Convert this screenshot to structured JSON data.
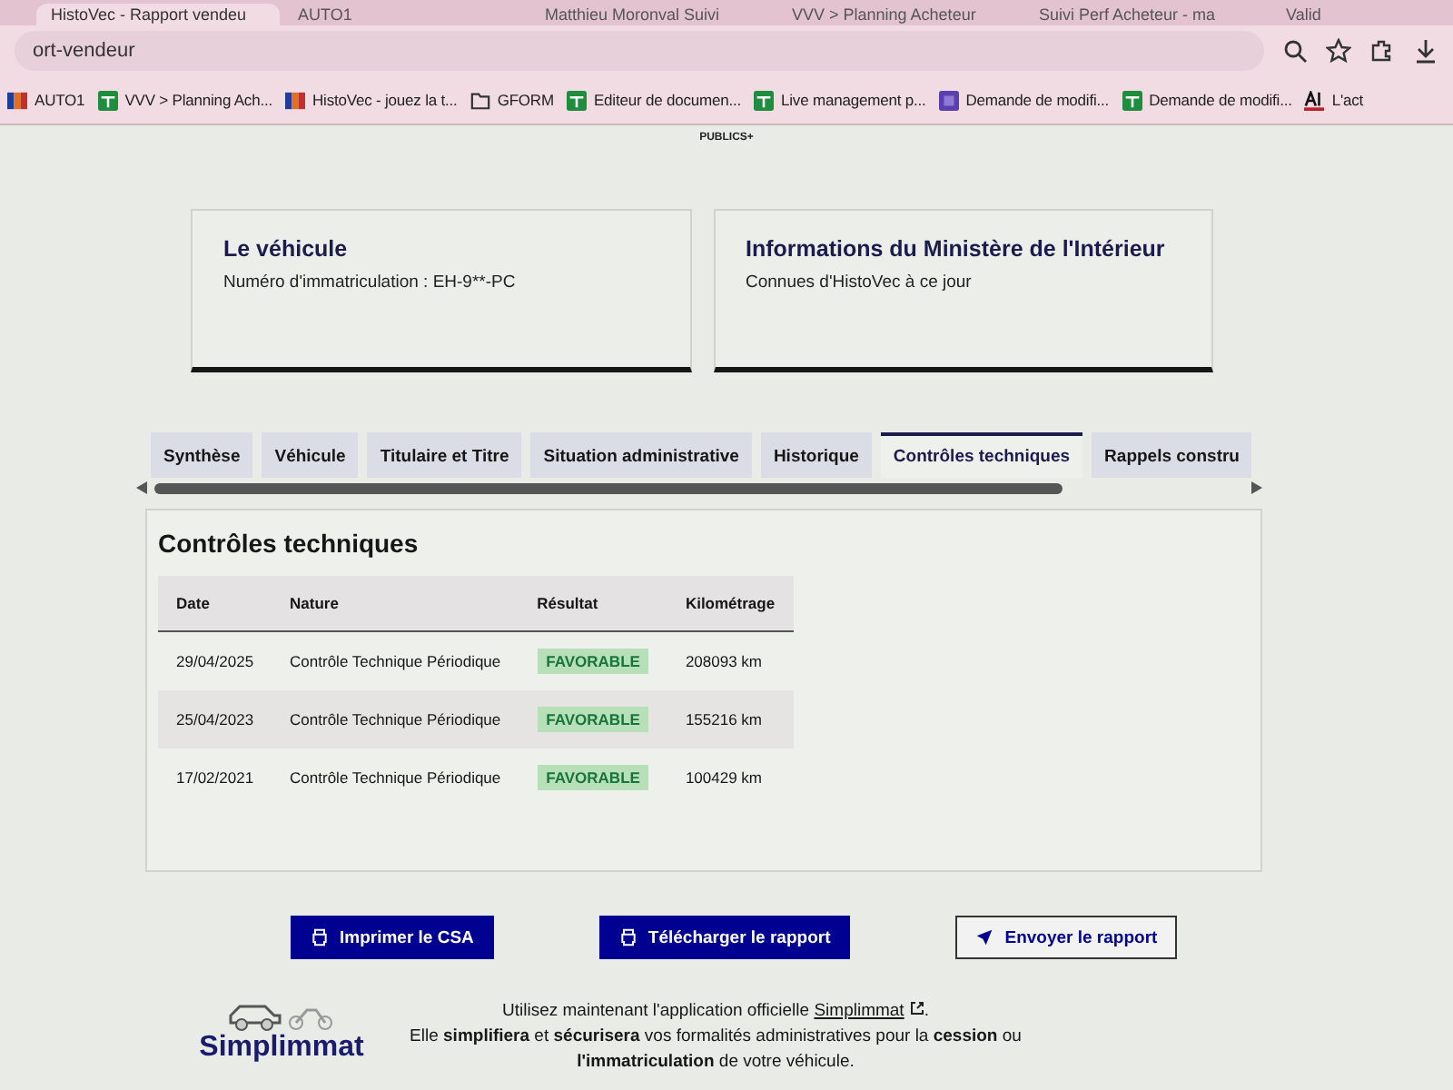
{
  "browser": {
    "tabs": [
      {
        "title": "HistoVec - Rapport vendeu",
        "selected": true
      },
      {
        "title": "AUTO1",
        "selected": false
      },
      {
        "title": "Matthieu Moronval Suivi",
        "selected": false
      },
      {
        "title": "VVV > Planning Acheteur",
        "selected": false
      },
      {
        "title": "Suivi Perf Acheteur - ma",
        "selected": false
      },
      {
        "title": "Valid",
        "selected": false
      }
    ],
    "address": "ort-vendeur",
    "bookmarks": [
      {
        "label": "AUTO1",
        "kind": "flag"
      },
      {
        "label": "VVV > Planning Ach...",
        "kind": "sheet"
      },
      {
        "label": "HistoVec - jouez la t...",
        "kind": "flag"
      },
      {
        "label": "GFORM",
        "kind": "folder"
      },
      {
        "label": "Editeur de documen...",
        "kind": "sheet"
      },
      {
        "label": "Live management p...",
        "kind": "sheet"
      },
      {
        "label": "Demande de modifi...",
        "kind": "form"
      },
      {
        "label": "Demande de modifi...",
        "kind": "sheet"
      },
      {
        "label": "L'act",
        "kind": "ai"
      }
    ]
  },
  "header": {
    "logo_text": "PUBLICS+"
  },
  "cards": [
    {
      "title": "Le véhicule",
      "text": "Numéro d'immatriculation : EH-9**-PC"
    },
    {
      "title": "Informations du Ministère de l'Intérieur",
      "text": "Connues d'HistoVec à ce jour"
    }
  ],
  "tabs": [
    {
      "label": "Synthèse",
      "selected": false
    },
    {
      "label": "Véhicule",
      "selected": false
    },
    {
      "label": "Titulaire et Titre",
      "selected": false
    },
    {
      "label": "Situation administrative",
      "selected": false
    },
    {
      "label": "Historique",
      "selected": false
    },
    {
      "label": "Contrôles techniques",
      "selected": true
    },
    {
      "label": "Rappels constru",
      "selected": false
    }
  ],
  "panel": {
    "title": "Contrôles techniques",
    "columns": [
      "Date",
      "Nature",
      "Résultat",
      "Kilométrage"
    ],
    "rows": [
      {
        "date": "29/04/2025",
        "nature": "Contrôle Technique Périodique",
        "result": "FAVORABLE",
        "mileage": "208093 km"
      },
      {
        "date": "25/04/2023",
        "nature": "Contrôle Technique Périodique",
        "result": "FAVORABLE",
        "mileage": "155216 km"
      },
      {
        "date": "17/02/2021",
        "nature": "Contrôle Technique Périodique",
        "result": "FAVORABLE",
        "mileage": "100429 km"
      }
    ]
  },
  "buttons": [
    {
      "label": "Imprimer le CSA",
      "kind": "primary"
    },
    {
      "label": "Télécharger le rapport",
      "kind": "primary"
    },
    {
      "label": "Envoyer le rapport",
      "kind": "secondary"
    }
  ],
  "footer": {
    "logo": "Simplimmat",
    "line1_before": "Utilisez maintenant l'application officielle ",
    "link": "Simplimmat",
    "line1_after": ".",
    "line2": "Elle **simplifiera** et **sécurisera** vos formalités administratives pour la **cession** ou **l'immatriculation** de votre véhicule."
  }
}
